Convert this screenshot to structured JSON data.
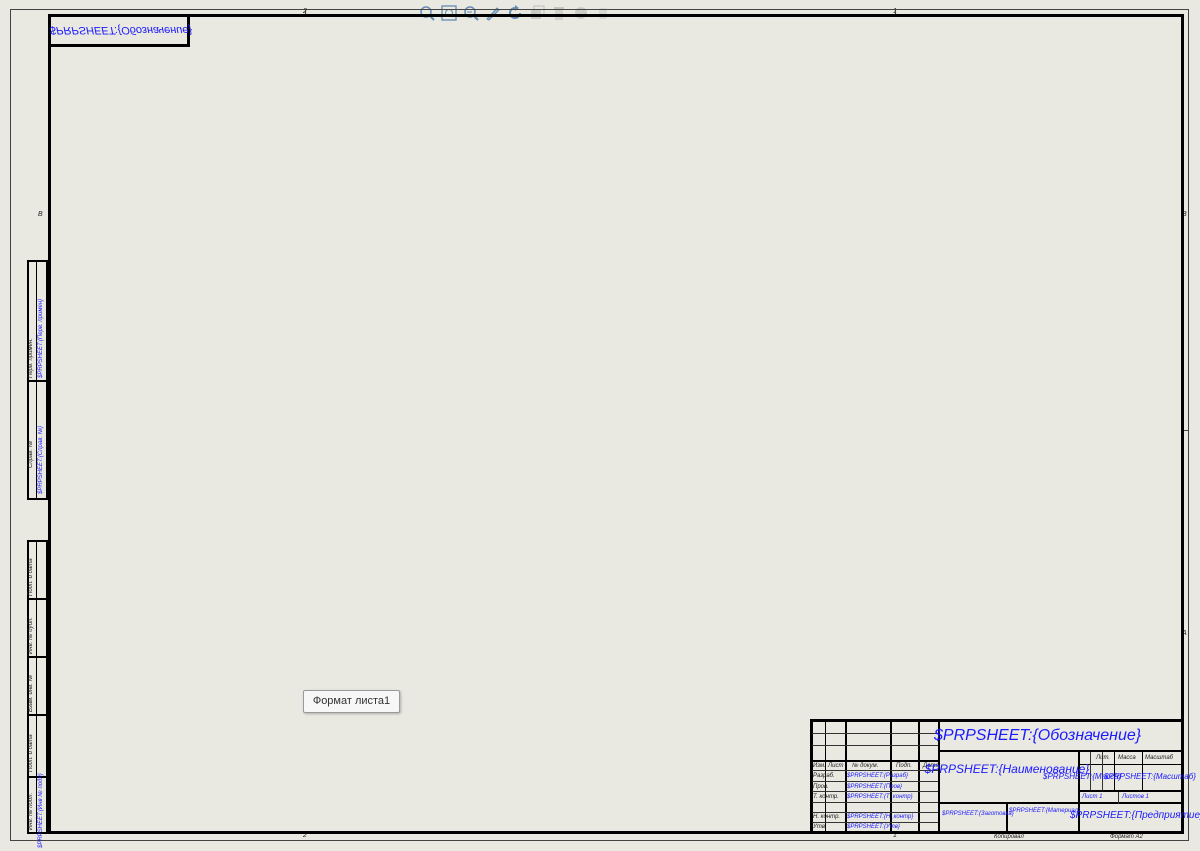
{
  "toolbar": {
    "icons": [
      "zoom-to-fit-icon",
      "zoom-area-icon",
      "zoom-previous-icon",
      "sketch-icon",
      "rotate-icon",
      "view-orientation-icon",
      "delete-icon",
      "display-style-icon",
      "hide-show-icon"
    ]
  },
  "frame": {
    "zone_top_2": "2",
    "zone_top_1": "1",
    "zone_bottom_2": "2",
    "zone_bottom_1": "1",
    "zone_left_B": "B",
    "zone_right_B": "B",
    "zone_right_A": "A"
  },
  "top_stamp": "$PRPSHEET:{Обозначение}",
  "side_strip": {
    "perv_primen_label": "Перв. примен.",
    "perv_primen_value": "$PRPSHEET:{Перв. примен}",
    "sprav_label": "Справ. №",
    "sprav_value": "$PRPSHEET:{Справ. №}",
    "podp_data_1": "Подп. и дата",
    "inv_dubl": "Инв. № дубл.",
    "vzam_inv": "Взам. инв. №",
    "podp_data_2": "Подп. и дата",
    "inv_podl": "Инв. № подл.",
    "inv_podl_value": "$PRPSHEET:{Инв № подл}"
  },
  "title_block": {
    "designation": "$PRPSHEET:{Обозначение}",
    "name": "$PRPSHEET:{Наименование}",
    "lit_label": "Лит.",
    "mass_label": "Масса",
    "scale_label": "Масштаб",
    "mass_value": "$PRPSHEET:{Масса}",
    "scale_value": "$PRPSHEET:{Масштаб}",
    "sheet_label": "Лист 1",
    "sheets_label": "Листов 1",
    "material": "$PRPSHEET:{Материал}",
    "blank": "$PRPSHEET:{Заготовка}",
    "enterprise": "$PRPSHEET:{Предприятие}",
    "copied": "Копировал",
    "format": "Формат А2",
    "rows": [
      {
        "role": "Изм.",
        "surname": "№ докум.",
        "sign": "Подп.",
        "date": "Дата"
      },
      {
        "role": "Разраб.",
        "surname": "$PRPSHEET:{Разраб}",
        "sign": "",
        "date": ""
      },
      {
        "role": "Пров.",
        "surname": "$PRPSHEET:{Пров}",
        "sign": "",
        "date": ""
      },
      {
        "role": "Т. контр.",
        "surname": "$PRPSHEET:{Т_контр}",
        "sign": "",
        "date": ""
      },
      {
        "role": "",
        "surname": "",
        "sign": "",
        "date": ""
      },
      {
        "role": "Н. контр.",
        "surname": "$PRPSHEET:{Н_контр}",
        "sign": "",
        "date": ""
      },
      {
        "role": "Утв.",
        "surname": "$PRPSHEET:{Утв}",
        "sign": "",
        "date": ""
      }
    ],
    "head_cols": [
      "Изм.",
      "Лист",
      "№ докум.",
      "Подп.",
      "Дата"
    ]
  },
  "tooltip": "Формат листа1"
}
